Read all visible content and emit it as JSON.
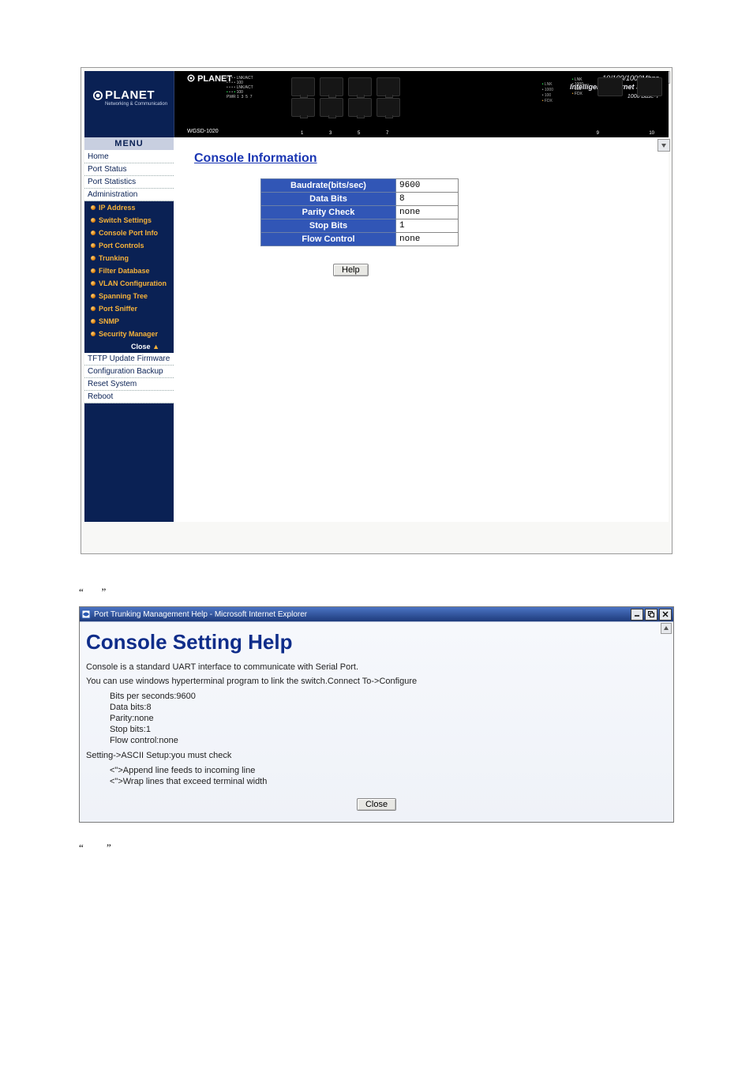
{
  "brand": {
    "name": "PLANET",
    "tagline": "Networking & Communication"
  },
  "device": {
    "title_line1": "10/100/1000Mbps",
    "title_line2": "Intelligent Ethernet Switch",
    "title_line3": "1000 Base-T",
    "model": "WGSD-1020"
  },
  "menu": {
    "header": "MENU",
    "items": [
      "Home",
      "Port Status",
      "Port Statistics",
      "Administration"
    ],
    "sub": [
      "IP Address",
      "Switch Settings",
      "Console Port Info",
      "Port Controls",
      "Trunking",
      "Filter Database",
      "VLAN Configuration",
      "Spanning Tree",
      "Port Sniffer",
      "SNMP",
      "Security Manager"
    ],
    "close": "Close",
    "items2": [
      "TFTP Update Firmware",
      "Configuration Backup",
      "Reset System",
      "Reboot"
    ]
  },
  "content": {
    "title": "Console Information",
    "rows": [
      {
        "k": "Baudrate(bits/sec)",
        "v": "9600"
      },
      {
        "k": "Data Bits",
        "v": "8"
      },
      {
        "k": "Parity Check",
        "v": "none"
      },
      {
        "k": "Stop Bits",
        "v": "1"
      },
      {
        "k": "Flow Control",
        "v": "none"
      }
    ],
    "help": "Help"
  },
  "help_window": {
    "title": "Port Trunking Management Help - Microsoft Internet Explorer",
    "heading": "Console Setting Help",
    "p1": "Console is a standard UART interface to communicate with Serial Port.",
    "p2": "You can use windows hyperterminal program to link the switch.Connect To->Configure",
    "lines": [
      "Bits per seconds:9600",
      "Data bits:8",
      "Parity:none",
      "Stop bits:1",
      "Flow control:none"
    ],
    "p3": "Setting->ASCII Setup:you must check",
    "lines2": [
      "<\">Append line feeds to incoming line",
      "<\">Wrap lines that exceed terminal width"
    ],
    "close": "Close"
  },
  "quotes": {
    "l": "“",
    "r": "”"
  }
}
